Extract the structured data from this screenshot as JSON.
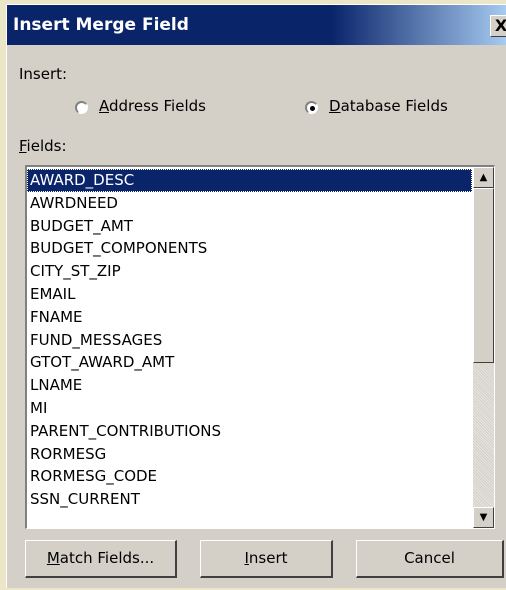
{
  "window": {
    "title": "Insert Merge Field",
    "close_glyph": "X"
  },
  "insert": {
    "label": "Insert:",
    "options": [
      {
        "label_mnemonic": "A",
        "label_rest": "ddress Fields",
        "selected": false
      },
      {
        "label_mnemonic": "D",
        "label_rest": "atabase Fields",
        "selected": true
      }
    ]
  },
  "fields": {
    "label_mnemonic": "F",
    "label_rest": "ields:",
    "selected_index": 0,
    "items": [
      "AWARD_DESC",
      "AWRDNEED",
      "BUDGET_AMT",
      "BUDGET_COMPONENTS",
      "CITY_ST_ZIP",
      "EMAIL",
      "FNAME",
      "FUND_MESSAGES",
      "GTOT_AWARD_AMT",
      "LNAME",
      "MI",
      "PARENT_CONTRIBUTIONS",
      "RORMESG",
      "RORMESG_CODE",
      "SSN_CURRENT"
    ]
  },
  "buttons": {
    "match_mnemonic": "M",
    "match_rest": "atch Fields...",
    "insert_mnemonic": "I",
    "insert_rest": "nsert",
    "cancel": "Cancel"
  },
  "icons": {
    "scroll_up": "scroll-up-arrow-icon",
    "scroll_down": "scroll-down-arrow-icon"
  }
}
